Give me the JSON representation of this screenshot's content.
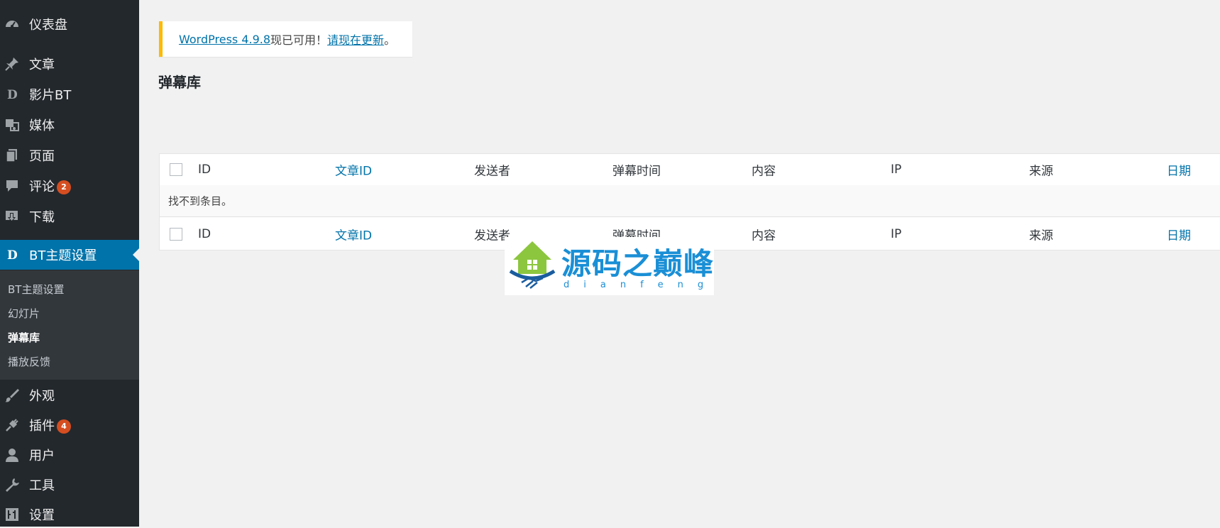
{
  "colors": {
    "sidebar_bg": "#23282d",
    "submenu_bg": "#32373c",
    "accent": "#0073aa",
    "badge": "#d54e21",
    "notice_border": "#ffb900",
    "watermark": "#1a8fd6"
  },
  "sidebar": {
    "items": [
      {
        "label": "仪表盘",
        "icon": "dashboard-icon"
      },
      {
        "label": "文章",
        "icon": "pin-icon"
      },
      {
        "label": "影片BT",
        "icon": "theme-d-icon"
      },
      {
        "label": "媒体",
        "icon": "media-icon"
      },
      {
        "label": "页面",
        "icon": "pages-icon"
      },
      {
        "label": "评论",
        "icon": "comment-icon",
        "badge": "2"
      },
      {
        "label": "下载",
        "icon": "download-icon"
      },
      {
        "label": "BT主题设置",
        "icon": "theme-d-icon"
      },
      {
        "label": "外观",
        "icon": "brush-icon"
      },
      {
        "label": "插件",
        "icon": "plugin-icon",
        "badge": "4"
      },
      {
        "label": "用户",
        "icon": "user-icon"
      },
      {
        "label": "工具",
        "icon": "wrench-icon"
      },
      {
        "label": "设置",
        "icon": "settings-icon"
      }
    ],
    "submenu": [
      "BT主题设置",
      "幻灯片",
      "弹幕库",
      "播放反馈"
    ]
  },
  "notice": {
    "link1": "WordPress 4.9.8",
    "text": "现已可用！",
    "link2": "请现在更新",
    "end": "。"
  },
  "page_title": "弹幕库",
  "table": {
    "columns": [
      "ID",
      "文章ID",
      "发送者",
      "弹幕时间",
      "内容",
      "IP",
      "来源",
      "日期"
    ],
    "empty_message": "找不到条目。"
  },
  "watermark": {
    "title": "源码之巅峰",
    "sub": "dianfeng"
  }
}
